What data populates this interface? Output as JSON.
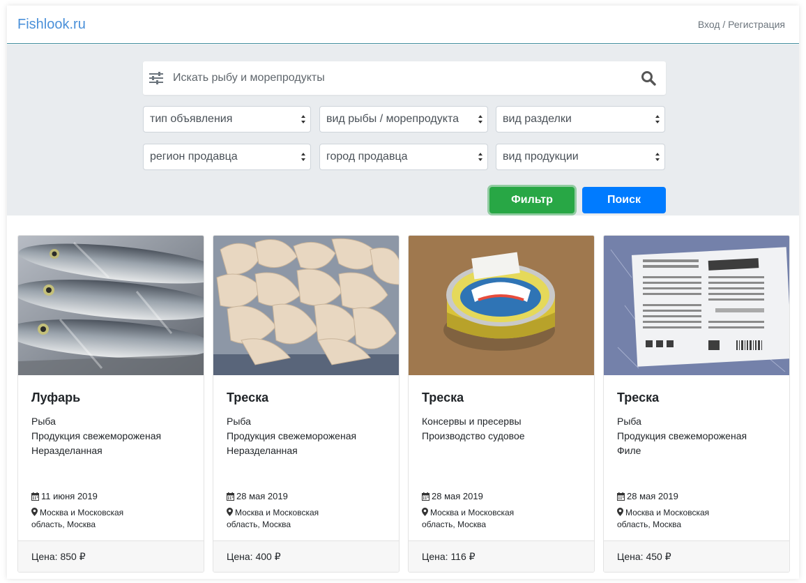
{
  "header": {
    "brand": "Fishlook.ru",
    "login": "Вход",
    "separator": " / ",
    "register": "Регистрация"
  },
  "search": {
    "placeholder": "Искать рыбу и морепродукты",
    "selects": [
      "тип объявления",
      "вид рыбы / морепродукта",
      "вид разделки",
      "регион продавца",
      "город продавца",
      "вид продукции"
    ],
    "filter_label": "Фильтр",
    "search_label": "Поиск"
  },
  "colors": {
    "brand": "#4a90d9",
    "filter_button": "#28a745",
    "search_button": "#007bff",
    "panel": "#e9ecef"
  },
  "listings": [
    {
      "title": "Луфарь",
      "lines": [
        "Рыба",
        "Продукция свежемороженая",
        "Неразделанная"
      ],
      "date": "11 июня 2019",
      "location": "Москва и Московская область, Москва",
      "price": "Цена: 850 ₽"
    },
    {
      "title": "Треска",
      "lines": [
        "Рыба",
        "Продукция свежемороженая",
        "Неразделанная"
      ],
      "date": "28 мая 2019",
      "location": "Москва и Московская область, Москва",
      "price": "Цена: 400 ₽"
    },
    {
      "title": "Треска",
      "lines": [
        "Консервы и пресервы",
        "Производство судовое",
        ""
      ],
      "date": "28 мая 2019",
      "location": "Москва и Московская область, Москва",
      "price": "Цена: 116 ₽"
    },
    {
      "title": "Треска",
      "lines": [
        "Рыба",
        "Продукция свежемороженая",
        "Филе"
      ],
      "date": "28 мая 2019",
      "location": "Москва и Московская область, Москва",
      "price": "Цена: 450 ₽"
    }
  ]
}
